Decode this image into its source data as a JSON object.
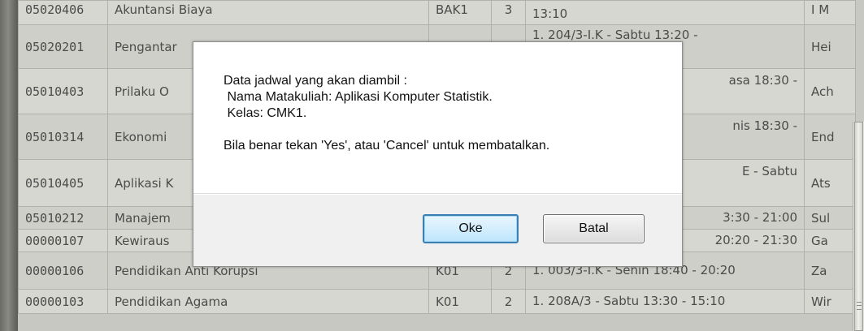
{
  "table": {
    "rows": [
      {
        "code": "05020406",
        "name": "Akuntansi Biaya",
        "kelas": "BAK1",
        "sks": "3",
        "jadwal": "13:10",
        "dosen": "I M"
      },
      {
        "code": "05020201",
        "name": "Pengantar",
        "kelas": "",
        "sks": "",
        "jadwal": "1. 204/3-I.K - Sabtu 13:20 -",
        "dosen": "Hei"
      },
      {
        "code": "05010403",
        "name": "Prilaku O",
        "kelas": "",
        "sks": "",
        "jadwal": "asa 18:30 -",
        "dosen": "Ach"
      },
      {
        "code": "05010314",
        "name": "Ekonomi",
        "kelas": "",
        "sks": "",
        "jadwal": "nis 18:30 -",
        "dosen": "End"
      },
      {
        "code": "05010405",
        "name": "Aplikasi K",
        "kelas": "",
        "sks": "",
        "jadwal": "E - Sabtu",
        "dosen": "Ats"
      },
      {
        "code": "05010212",
        "name": "Manajem",
        "kelas": "",
        "sks": "",
        "jadwal": "3:30 - 21:00",
        "dosen": "Sul"
      },
      {
        "code": "00000107",
        "name": "Kewiraus",
        "kelas": "",
        "sks": "",
        "jadwal": "20:20 - 21:30",
        "dosen": "Ga"
      },
      {
        "code": "00000106",
        "name": "Pendidikan Anti Korupsi",
        "kelas": "K01",
        "sks": "2",
        "jadwal": "1. 003/3-I.K - Senin 18:40 - 20:20",
        "dosen": "Za"
      },
      {
        "code": "00000103",
        "name": "Pendidikan Agama",
        "kelas": "K01",
        "sks": "2",
        "jadwal": "1. 208A/3 - Sabtu 13:30 - 15:10",
        "dosen": "Wir"
      }
    ]
  },
  "dialog": {
    "line1": "Data jadwal yang akan diambil :",
    "line2": " Nama Matakuliah: Aplikasi Komputer Statistik.",
    "line3": " Kelas: CMK1.",
    "line4": "Bila benar tekan 'Yes', atau 'Cancel' untuk membatalkan.",
    "ok_label": "Oke",
    "cancel_label": "Batal"
  }
}
